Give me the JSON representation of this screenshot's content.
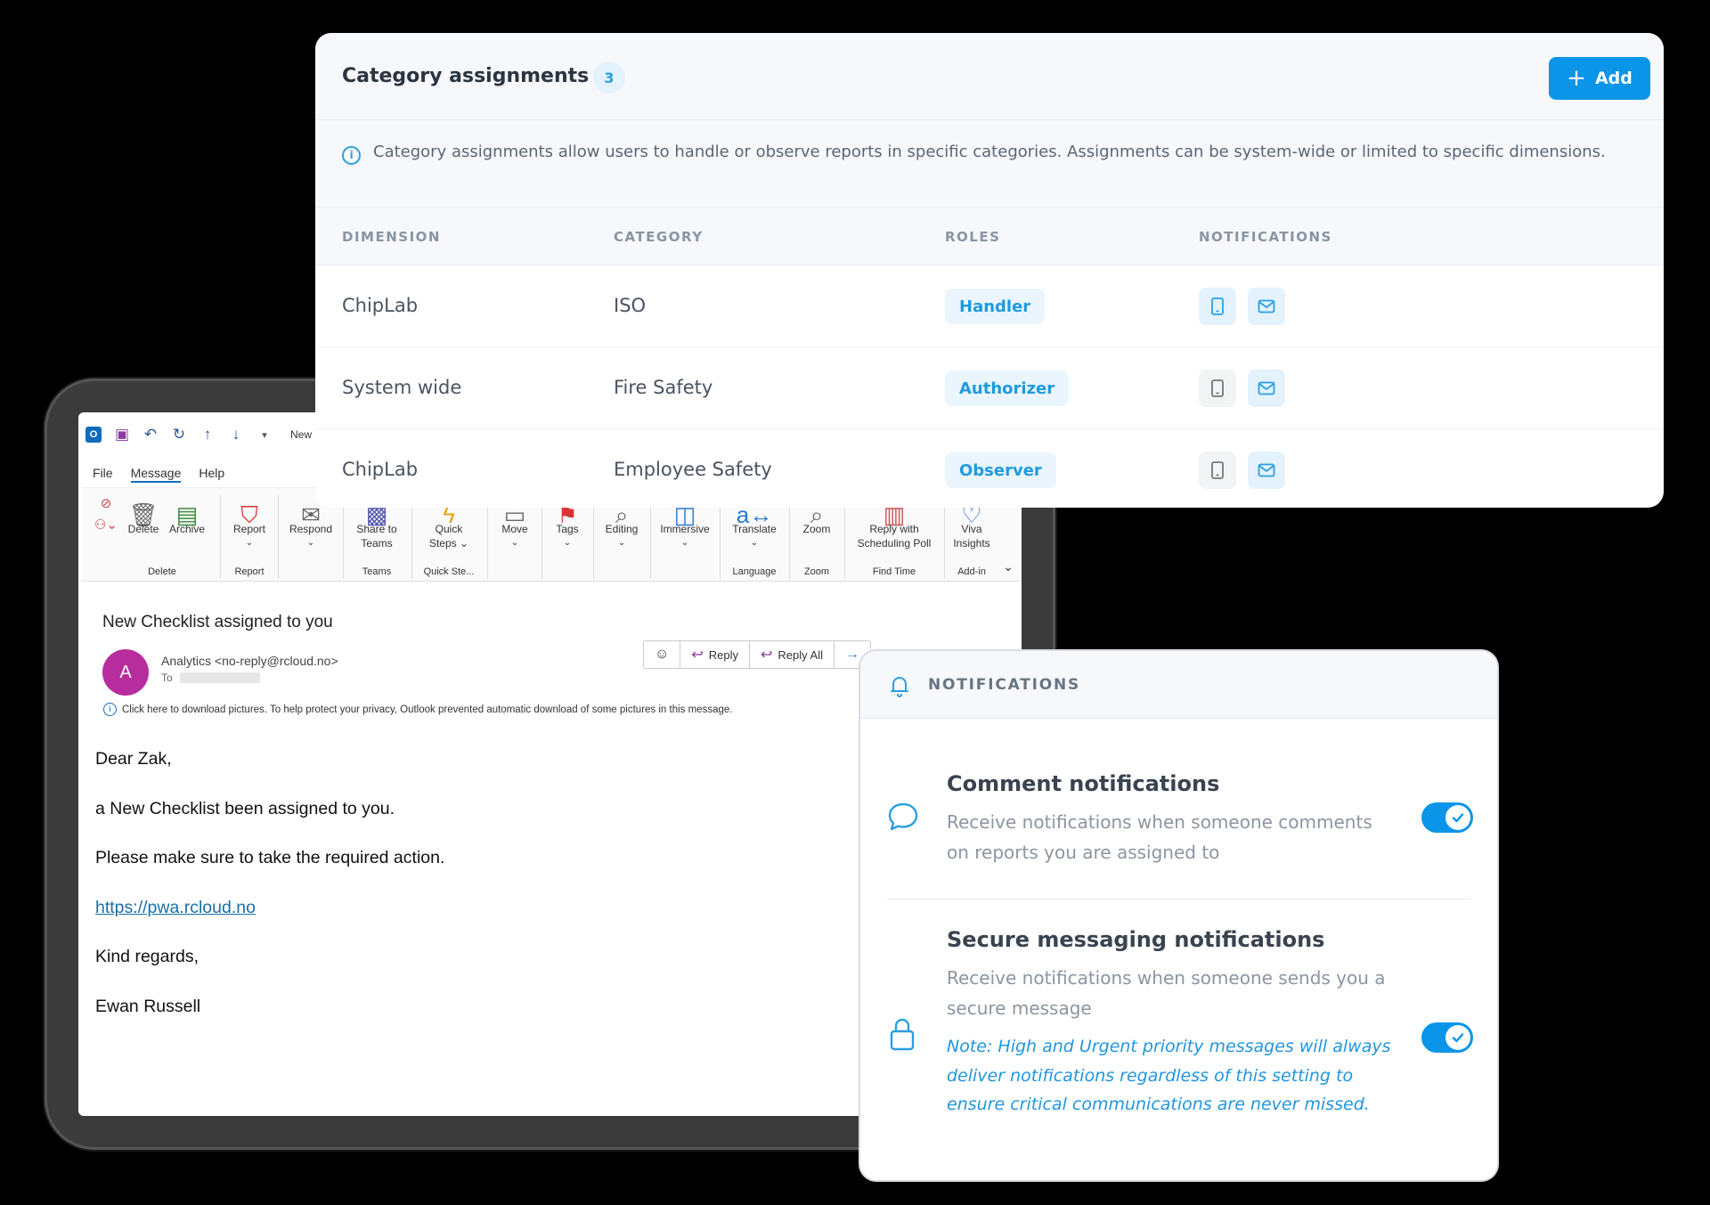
{
  "outlook": {
    "qat_title_fragment": "New",
    "menu": [
      "File",
      "Message",
      "Help"
    ],
    "ribbon": {
      "delete": "Delete",
      "archive": "Archive",
      "report": "Report",
      "respond": "Respond",
      "share_teams_1": "Share to",
      "share_teams_2": "Teams",
      "quick_steps_1": "Quick",
      "quick_steps_2": "Steps ⌄",
      "move": "Move",
      "tags": "Tags",
      "editing": "Editing",
      "immersive": "Immersive",
      "translate": "Translate",
      "zoom": "Zoom",
      "reply_poll_1": "Reply with",
      "reply_poll_2": "Scheduling Poll",
      "viva_1": "Viva",
      "viva_2": "Insights",
      "groups": {
        "delete": "Delete",
        "report": "Report",
        "teams": "Teams",
        "quick_steps": "Quick Ste...",
        "language": "Language",
        "zoom": "Zoom",
        "find_time": "Find Time",
        "addin": "Add-in"
      }
    },
    "message": {
      "subject": "New Checklist assigned to you",
      "avatar_letter": "A",
      "sender": "Analytics <no-reply@rcloud.no>",
      "to_label": "To",
      "privacy_notice": "Click here to download pictures. To help protect your privacy, Outlook prevented automatic download of some pictures in this message.",
      "reply": "Reply",
      "reply_all": "Reply All",
      "body": {
        "greeting": "Dear Zak,",
        "line1": "a New Checklist been assigned to you.",
        "line2": "Please make sure to take the required action.",
        "link": "https://pwa.rcloud.no",
        "closing": "Kind regards,",
        "signature": "Ewan Russell"
      }
    }
  },
  "category_assignments": {
    "title": "Category assignments",
    "count": "3",
    "add_label": "Add",
    "info": "Category assignments allow users to handle or observe reports in specific categories. Assignments can be system-wide or limited to specific dimensions.",
    "columns": [
      "DIMENSION",
      "CATEGORY",
      "ROLES",
      "NOTIFICATIONS"
    ],
    "rows": [
      {
        "dimension": "ChipLab",
        "category": "ISO",
        "role": "Handler",
        "mobile_on": true,
        "email_on": true
      },
      {
        "dimension": "System wide",
        "category": "Fire Safety",
        "role": "Authorizer",
        "mobile_on": false,
        "email_on": true
      },
      {
        "dimension": "ChipLab",
        "category": "Employee Safety",
        "role": "Observer",
        "mobile_on": false,
        "email_on": true
      }
    ],
    "colors": {
      "accent": "#0b95e8",
      "badge_bg": "#eaf5fd"
    }
  },
  "notifications": {
    "header": "NOTIFICATIONS",
    "items": [
      {
        "title": "Comment notifications",
        "description": "Receive notifications when someone comments on reports you are assigned to",
        "enabled": true,
        "icon": "chat-bubble-icon"
      },
      {
        "title": "Secure messaging notifications",
        "description": "Receive notifications when someone sends you a secure message",
        "note": "Note: High and Urgent priority messages will always deliver notifications regardless of this setting to ensure critical communications are never missed.",
        "enabled": true,
        "icon": "lock-icon"
      }
    ]
  }
}
